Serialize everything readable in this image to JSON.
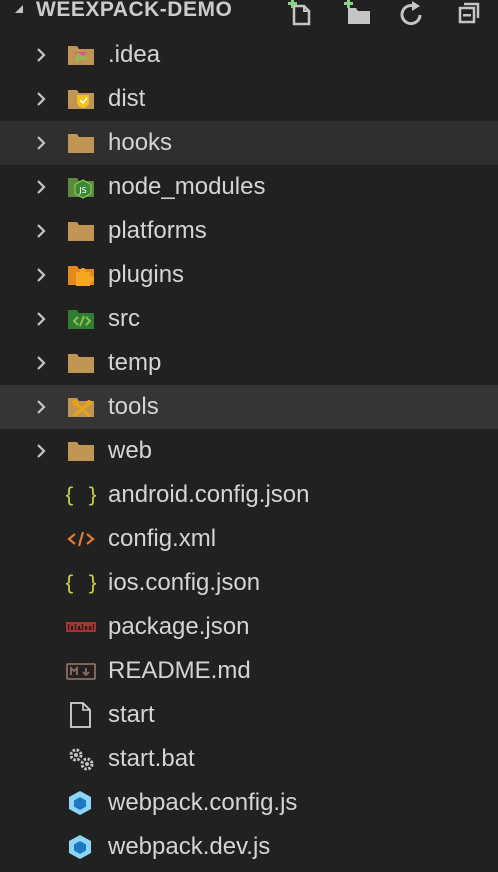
{
  "explorer": {
    "section_title": "WEEXPACK-DEMO",
    "actions": [
      {
        "name": "new-file-icon"
      },
      {
        "name": "new-folder-icon"
      },
      {
        "name": "refresh-icon"
      },
      {
        "name": "collapse-all-icon"
      }
    ]
  },
  "tree": {
    "folders": [
      {
        "label": ".idea",
        "icon": "idea-folder-icon"
      },
      {
        "label": "dist",
        "icon": "dist-folder-icon"
      },
      {
        "label": "hooks",
        "icon": "folder-icon"
      },
      {
        "label": "node_modules",
        "icon": "node-folder-icon"
      },
      {
        "label": "platforms",
        "icon": "folder-icon"
      },
      {
        "label": "plugins",
        "icon": "plugin-folder-icon"
      },
      {
        "label": "src",
        "icon": "src-folder-icon"
      },
      {
        "label": "temp",
        "icon": "folder-icon"
      },
      {
        "label": "tools",
        "icon": "tools-folder-icon"
      },
      {
        "label": "web",
        "icon": "folder-icon"
      }
    ],
    "files": [
      {
        "label": "android.config.json",
        "icon": "json-icon"
      },
      {
        "label": "config.xml",
        "icon": "xml-icon"
      },
      {
        "label": "ios.config.json",
        "icon": "json-icon"
      },
      {
        "label": "package.json",
        "icon": "npm-icon"
      },
      {
        "label": "README.md",
        "icon": "markdown-icon"
      },
      {
        "label": "start",
        "icon": "file-icon"
      },
      {
        "label": "start.bat",
        "icon": "gear-icon"
      },
      {
        "label": "webpack.config.js",
        "icon": "webpack-icon"
      },
      {
        "label": "webpack.dev.js",
        "icon": "webpack-icon"
      }
    ],
    "hovered": "hooks",
    "selected": "tools",
    "colors": {
      "folder": "#c09553",
      "json": "#cbcb41",
      "xml": "#e37933",
      "npm": "#cb3837",
      "webpack": "#8dd6f9",
      "src": "#4caf50",
      "background": "#212121"
    }
  }
}
